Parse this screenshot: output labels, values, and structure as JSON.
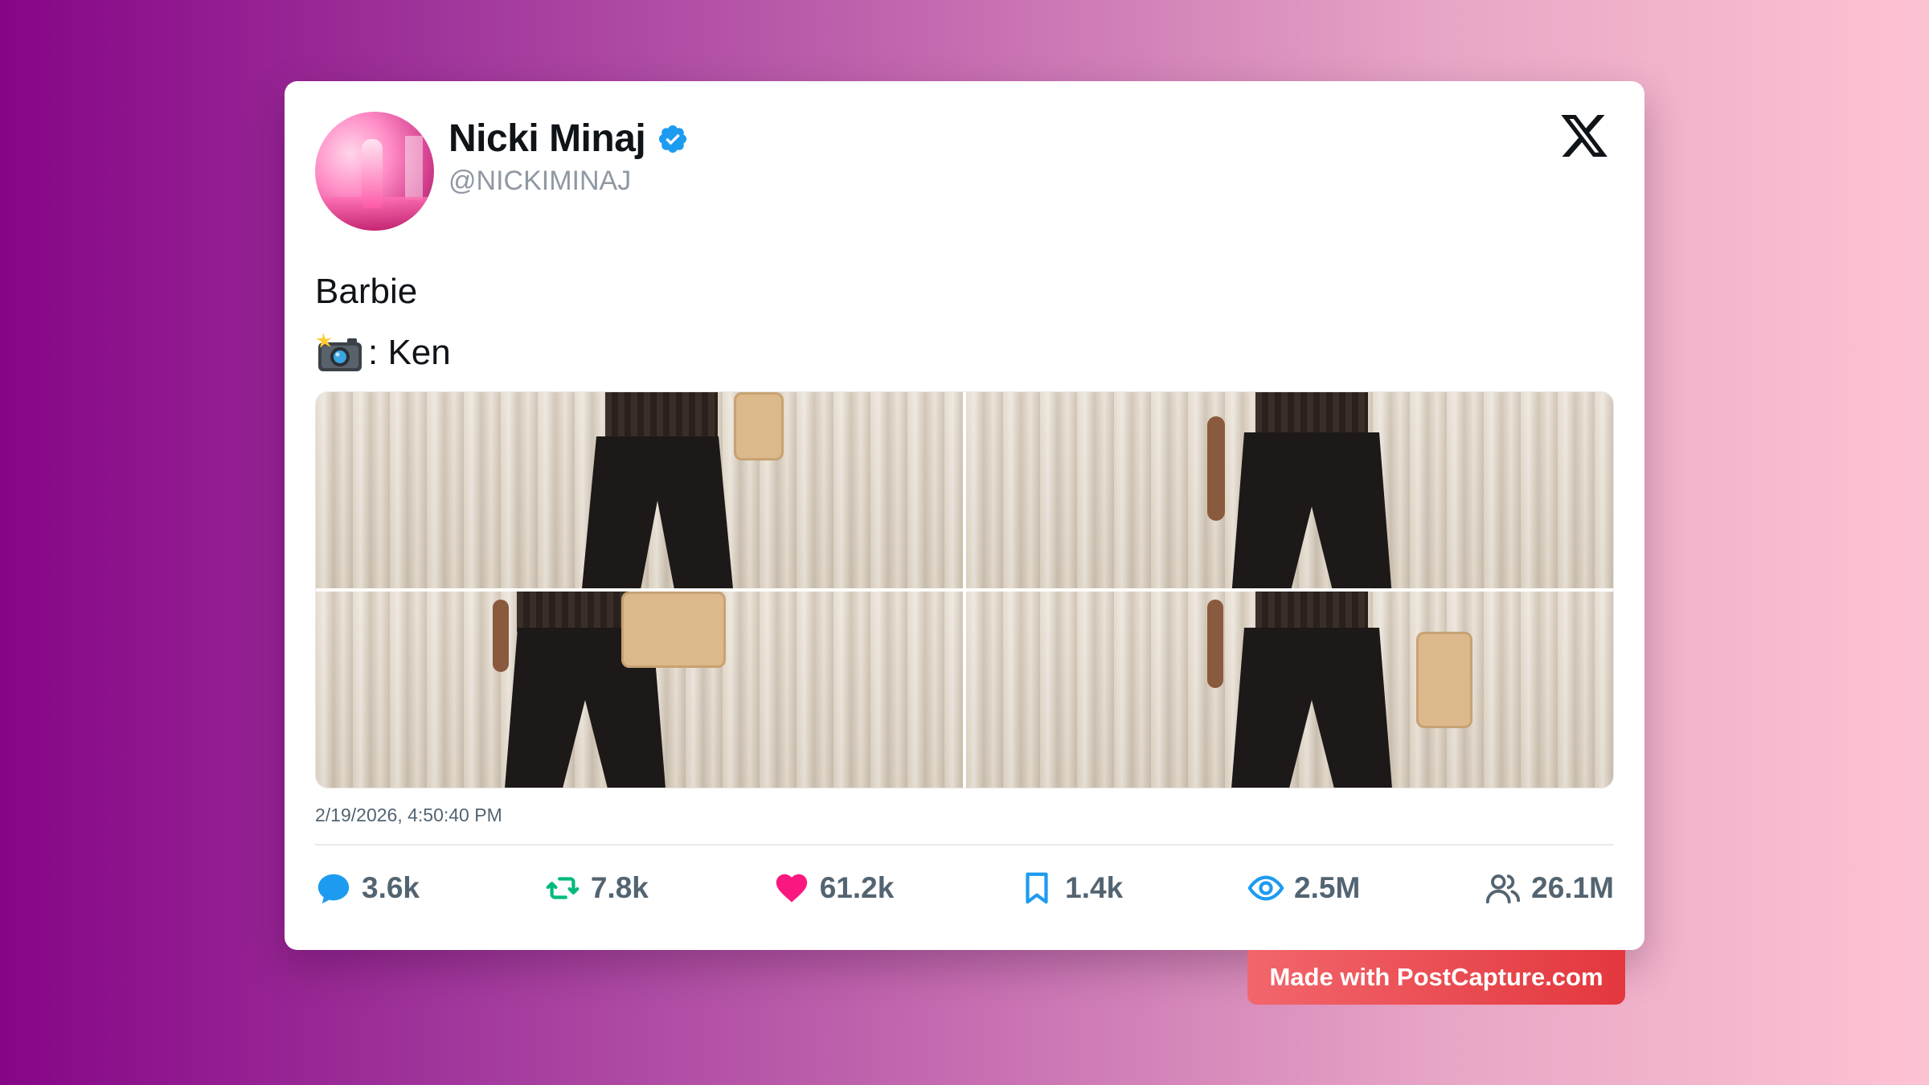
{
  "post": {
    "author": {
      "display_name": "Nicki Minaj",
      "handle": "@NICKIMINAJ",
      "verified": true,
      "verified_color": "#1d9bf0"
    },
    "text_lines": [
      "Barbie",
      ": Ken"
    ],
    "text_emoji": "camera-with-flash-icon",
    "media_count": 4,
    "timestamp": "2/19/2026, 4:50:40 PM",
    "stats": {
      "replies": "3.6k",
      "reposts": "7.8k",
      "likes": "61.2k",
      "bookmarks": "1.4k",
      "views": "2.5M",
      "followers": "26.1M"
    },
    "stat_colors": {
      "replies": "#1d9bf0",
      "reposts": "#00ba7c",
      "likes": "#f91880",
      "bookmarks": "#1d9bf0",
      "views": "#1d9bf0",
      "followers": "#536471"
    }
  },
  "brand": {
    "logo": "x-logo-icon"
  },
  "watermark": {
    "label": "Made with PostCapture.com"
  }
}
